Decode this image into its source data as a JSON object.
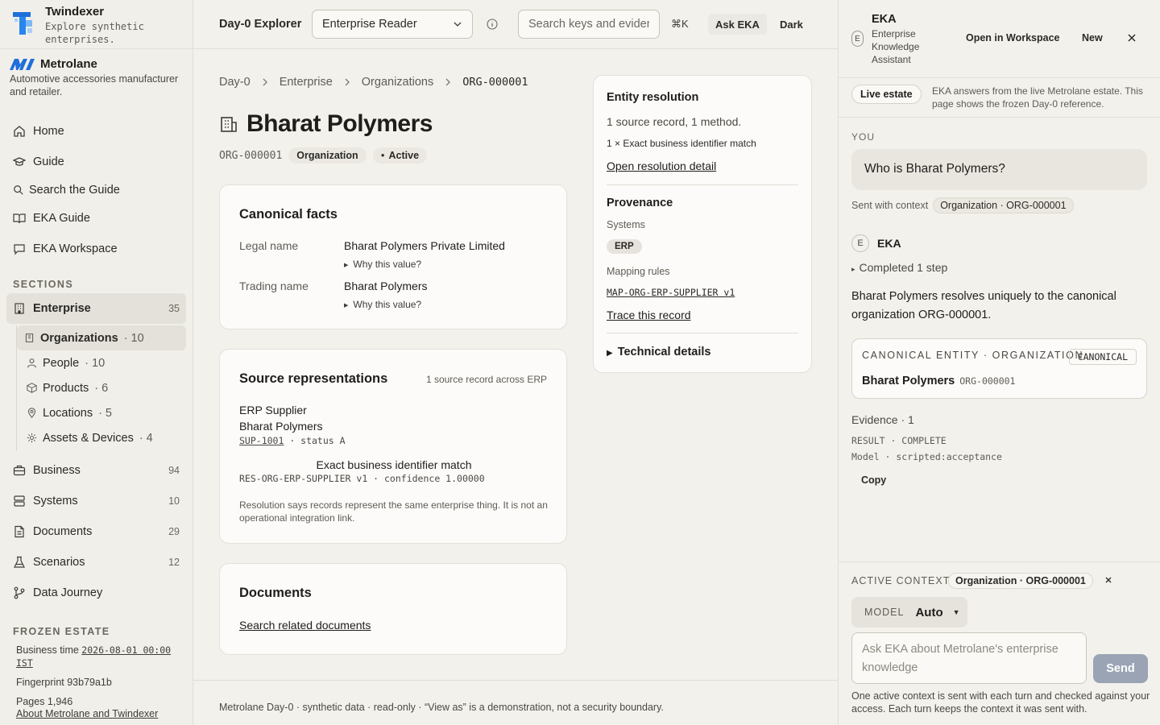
{
  "brand": {
    "name": "Twindexer",
    "tagline": "Explore synthetic enterprises."
  },
  "org": {
    "name": "Metrolane",
    "description": "Automotive accessories manufacturer and retailer."
  },
  "nav": {
    "home": "Home",
    "guide": "Guide",
    "search_guide": "Search the Guide",
    "eka_guide": "EKA Guide",
    "eka_workspace": "EKA Workspace"
  },
  "sections": {
    "label": "SECTIONS",
    "enterprise": {
      "label": "Enterprise",
      "count": "35"
    },
    "sub": [
      {
        "label": "Organizations",
        "count": "· 10"
      },
      {
        "label": "People",
        "count": "· 10"
      },
      {
        "label": "Products",
        "count": "· 6"
      },
      {
        "label": "Locations",
        "count": "· 5"
      },
      {
        "label": "Assets & Devices",
        "count": "· 4"
      }
    ],
    "business": {
      "label": "Business",
      "count": "94"
    },
    "systems": {
      "label": "Systems",
      "count": "10"
    },
    "documents": {
      "label": "Documents",
      "count": "29"
    },
    "scenarios": {
      "label": "Scenarios",
      "count": "12"
    },
    "journey": {
      "label": "Data Journey"
    }
  },
  "frozen": {
    "label": "FROZEN ESTATE",
    "business_time_label": "Business time",
    "business_time": "2026-08-01 00:00 IST",
    "fingerprint": "Fingerprint 93b79a1b",
    "pages": "Pages 1,946",
    "about": "About Metrolane and Twindexer"
  },
  "topbar": {
    "title": "Day-0 Explorer",
    "view_as": "Enterprise Reader",
    "search_placeholder": "Search keys and evidence",
    "shortcut": "⌘K",
    "ask": "Ask EKA",
    "theme": "Dark"
  },
  "breadcrumb": [
    "Day-0",
    "Enterprise",
    "Organizations",
    "ORG-000001"
  ],
  "entity": {
    "name": "Bharat Polymers",
    "id": "ORG-000001",
    "type": "Organization",
    "status": "Active"
  },
  "canonical": {
    "title": "Canonical facts",
    "legal_label": "Legal name",
    "legal_value": "Bharat Polymers Private Limited",
    "trading_label": "Trading name",
    "trading_value": "Bharat Polymers",
    "why": "Why this value?"
  },
  "sources": {
    "title": "Source representations",
    "summary": "1 source record across ERP",
    "system": "ERP Supplier",
    "name": "Bharat Polymers",
    "id": "SUP-1001",
    "status": " · status A",
    "match": "Exact business identifier match",
    "rule": "RES-ORG-ERP-SUPPLIER v1 · confidence 1.00000",
    "note": "Resolution says records represent the same enterprise thing. It is not an operational integration link."
  },
  "documents": {
    "title": "Documents",
    "link": "Search related documents"
  },
  "resolution": {
    "title": "Entity resolution",
    "summary": "1 source record, 1 method.",
    "method": "1 × Exact business identifier match",
    "link": "Open resolution detail"
  },
  "provenance": {
    "title": "Provenance",
    "systems_label": "Systems",
    "system": "ERP",
    "rules_label": "Mapping rules",
    "rule": "MAP-ORG-ERP-SUPPLIER v1",
    "trace": "Trace this record",
    "technical": "Technical details"
  },
  "footer": "Metrolane Day-0 · synthetic data · read-only · “View as” is a demonstration, not a security boundary.",
  "eka": {
    "badge": "E",
    "title": "EKA",
    "subtitle": "Enterprise Knowledge Assistant",
    "open": "Open in Workspace",
    "new": "New",
    "live": "Live estate",
    "live_text": "EKA answers from the live Metrolane estate. This page shows the frozen Day-0 reference.",
    "you": "YOU",
    "question": "Who is Bharat Polymers?",
    "sent_with": "Sent with context",
    "context": "Organization · ORG-000001",
    "assistant": "EKA",
    "completed": "Completed 1 step",
    "answer": "Bharat Polymers resolves uniquely to the canonical organization ORG-000001.",
    "canon_label": "CANONICAL ENTITY · ORGANIZATION",
    "canon_pill": "CANONICAL",
    "canon_name": "Bharat Polymers",
    "canon_id": "ORG-000001",
    "evidence": "Evidence · 1",
    "result": "RESULT · COMPLETE",
    "model_line": "Model · scripted:acceptance",
    "copy": "Copy",
    "active_label": "ACTIVE CONTEXT",
    "active_context": "Organization · ORG-000001",
    "model_label": "MODEL",
    "model_value": "Auto",
    "input_placeholder": "Ask EKA about Metrolane's enterprise knowledge",
    "send": "Send",
    "help": "One active context is sent with each turn and checked against your access. Each turn keeps the context it was sent with."
  },
  "colors": {
    "page": "#f3f1ec",
    "card": "#fcfbf9",
    "send": "#9aa4b5",
    "brand_blue": "#1e6fd9"
  }
}
